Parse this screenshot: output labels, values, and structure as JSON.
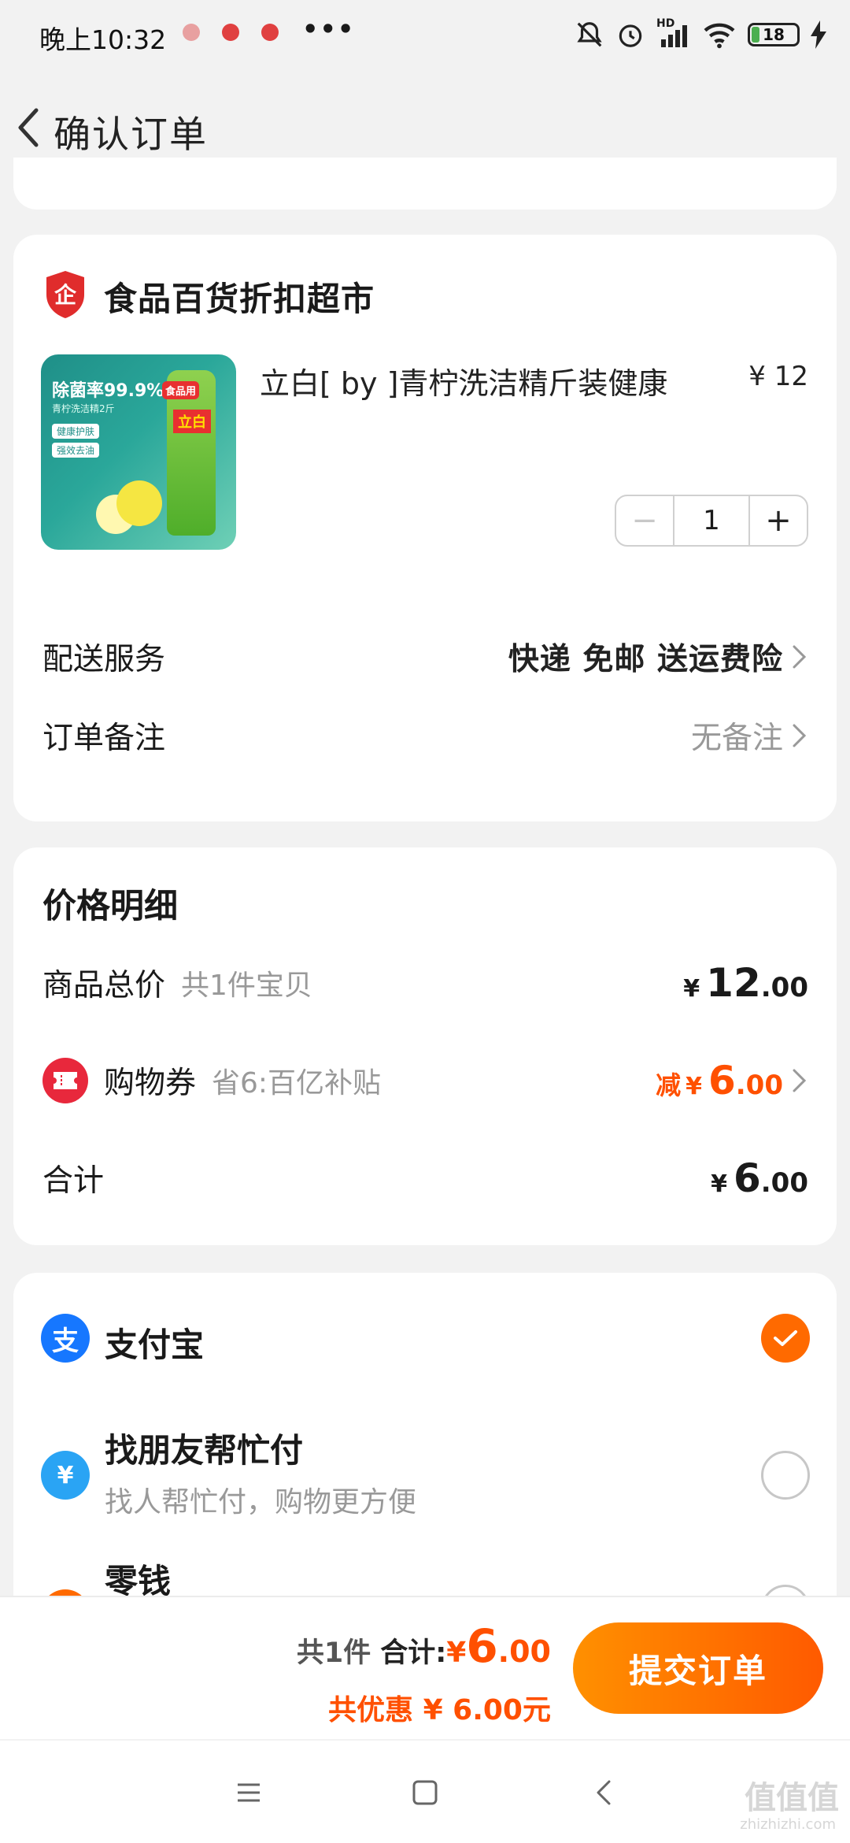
{
  "status_bar": {
    "time": "晚上10:32",
    "dots": "•••",
    "battery": "18",
    "network": "HD"
  },
  "header": {
    "title": "确认订单"
  },
  "shop": {
    "name": "食品百货折扣超市",
    "icon_char": "企",
    "product": {
      "title": "立白[ by ]青柠洗洁精斤装健康",
      "price": "¥ 12",
      "image_text": {
        "headline": "除菌率99.9%",
        "subline": "青柠洗洁精2斤",
        "tag1": "健康护肤",
        "tag2": "强效去油",
        "badge": "食品用",
        "brand": "立白"
      },
      "quantity": "1",
      "minus": "−",
      "plus": "+"
    },
    "delivery": {
      "label": "配送服务",
      "value": "快递 免邮 送运费险"
    },
    "remark": {
      "label": "订单备注",
      "value": "无备注"
    }
  },
  "price_detail": {
    "title": "价格明细",
    "goods_total": {
      "label": "商品总价",
      "sub": "共1件宝贝",
      "currency": "¥",
      "int": "12",
      "dec": ".00"
    },
    "coupon": {
      "label": "购物券",
      "sub": "省6:百亿补贴",
      "prefix": "减",
      "currency": "¥",
      "int": "6",
      "dec": ".00"
    },
    "total": {
      "label": "合计",
      "currency": "¥",
      "int": "6",
      "dec": ".00"
    }
  },
  "payment": {
    "alipay": {
      "label": "支付宝",
      "icon_char": "支",
      "selected": true
    },
    "friend_pay": {
      "label": "找朋友帮忙付",
      "sub": "找人帮忙付，购物更方便",
      "icon_char": "¥"
    },
    "change": {
      "label": "零钱"
    }
  },
  "bottom": {
    "count": "共1件",
    "total_label": "合计:",
    "currency": "¥",
    "int": "6",
    "dec": ".00",
    "saving": "共优惠 ¥ 6.00元",
    "submit": "提交订单"
  },
  "watermark": {
    "main": "值值值",
    "sub": "zhizhizhi.com"
  },
  "colors": {
    "accent": "#ff5000",
    "submit_start": "#ff9000",
    "submit_end": "#ff5a00",
    "alipay_blue": "#1677ff",
    "coupon_red": "#e8283c"
  }
}
